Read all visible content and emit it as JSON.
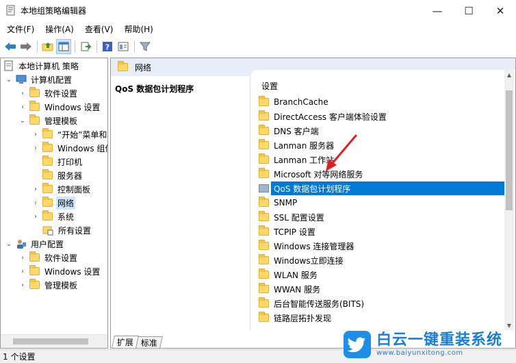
{
  "window": {
    "title": "本地组策略编辑器",
    "minimize_glyph": "—",
    "maximize_glyph": "☐",
    "close_glyph": "✕"
  },
  "menu": [
    "文件(F)",
    "操作(A)",
    "查看(V)",
    "帮助(H)"
  ],
  "tree": {
    "root": "本地计算机 策略",
    "computer_config": "计算机配置",
    "software_settings": "软件设置",
    "windows_settings": "Windows 设置",
    "admin_templates": "管理模板",
    "start_menu": "“开始”菜单和",
    "windows_components": "Windows 组件",
    "printers": "打印机",
    "servers": "服务器",
    "control_panel": "控制面板",
    "network": "网络",
    "system": "系统",
    "all_settings": "所有设置",
    "user_config": "用户配置",
    "user_software": "软件设置",
    "user_windows": "Windows 设置",
    "user_admin": "管理模板"
  },
  "right": {
    "header": "网络",
    "selected_title": "QoS 数据包计划程序",
    "column_header": "设置",
    "items": [
      "BranchCache",
      "DirectAccess 客户端体验设置",
      "DNS 客户端",
      "Lanman 服务器",
      "Lanman 工作站",
      "Microsoft 对等网络服务",
      "QoS 数据包计划程序",
      "SNMP",
      "SSL 配置设置",
      "TCPIP 设置",
      "Windows 连接管理器",
      "Windows立即连接",
      "WLAN 服务",
      "WWAN 服务",
      "后台智能传送服务(BITS)",
      "链路层拓扑发现"
    ],
    "selected_index": 6
  },
  "tabs": [
    "扩展",
    "标准"
  ],
  "status": "1 个设置",
  "colors": {
    "accent": "#0078d7",
    "selection_light": "#cce8ff",
    "folder": "#ffd867",
    "annotation_arrow": "#e02020",
    "watermark_blue": "#1a7ed8"
  },
  "watermark": {
    "text": "白云一键重装系统",
    "url": "www.baiyunxitong.com"
  }
}
